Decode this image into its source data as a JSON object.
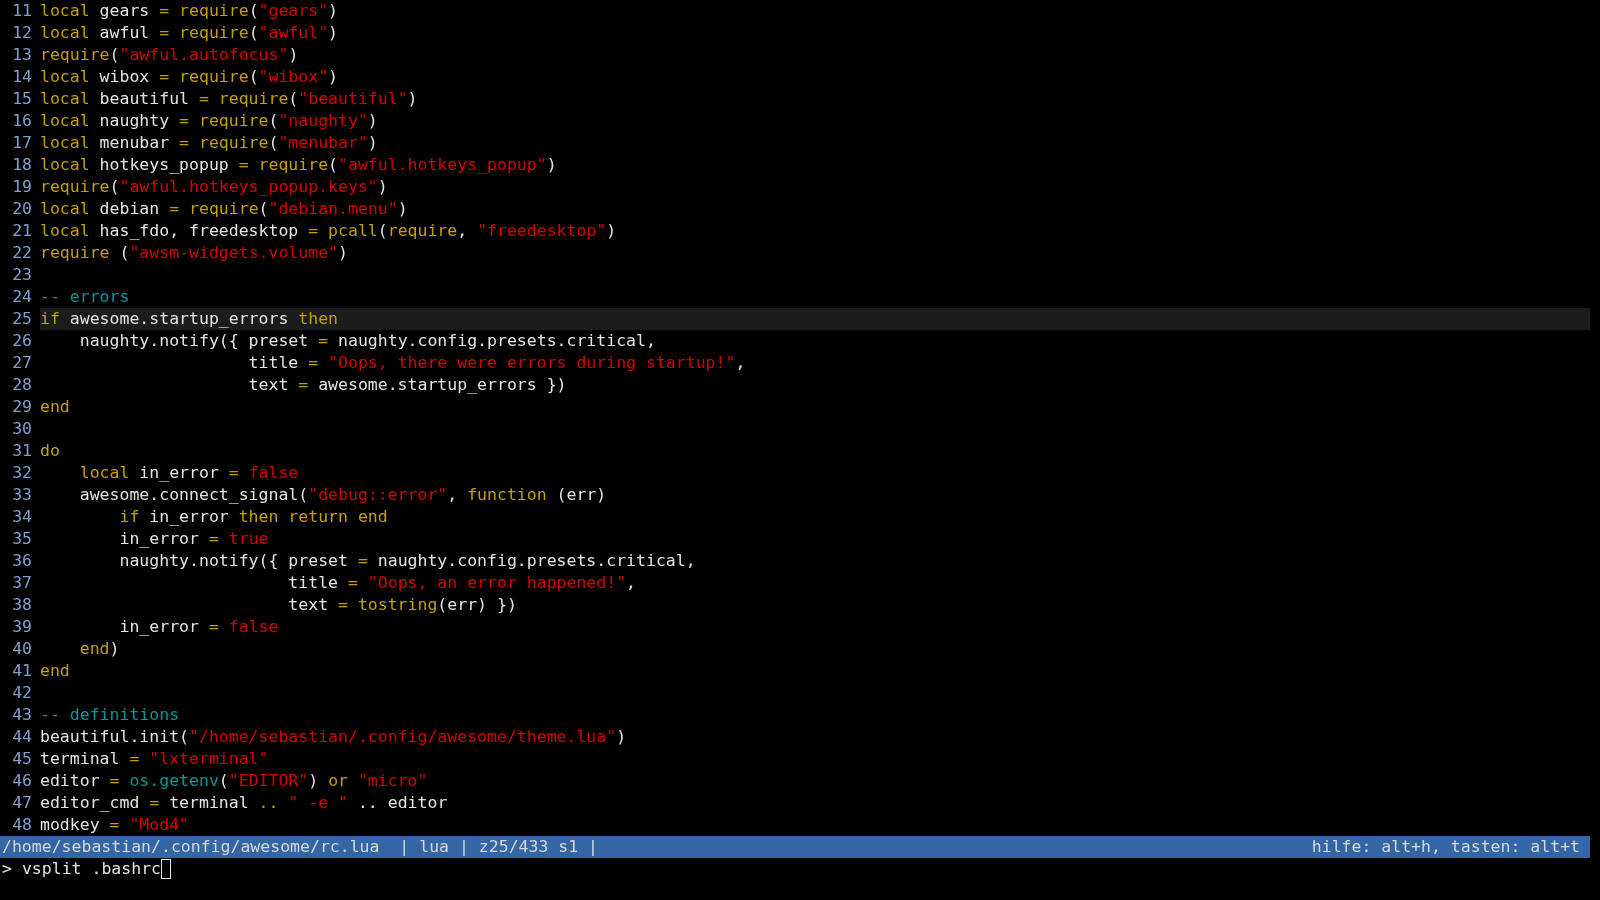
{
  "editor": {
    "lines": [
      {
        "number": "11",
        "current": false,
        "segments": [
          {
            "kind": "keyword",
            "text": "local"
          },
          {
            "kind": "plain",
            "text": " gears "
          },
          {
            "kind": "keyword",
            "text": "= require"
          },
          {
            "kind": "plain",
            "text": "("
          },
          {
            "kind": "string",
            "text": "\"gears\""
          },
          {
            "kind": "plain",
            "text": ")"
          }
        ]
      },
      {
        "number": "12",
        "current": false,
        "segments": [
          {
            "kind": "keyword",
            "text": "local"
          },
          {
            "kind": "plain",
            "text": " awful "
          },
          {
            "kind": "keyword",
            "text": "= require"
          },
          {
            "kind": "plain",
            "text": "("
          },
          {
            "kind": "string",
            "text": "\"awful\""
          },
          {
            "kind": "plain",
            "text": ")"
          }
        ]
      },
      {
        "number": "13",
        "current": false,
        "segments": [
          {
            "kind": "keyword",
            "text": "require"
          },
          {
            "kind": "plain",
            "text": "("
          },
          {
            "kind": "string",
            "text": "\"awful.autofocus\""
          },
          {
            "kind": "plain",
            "text": ")"
          }
        ]
      },
      {
        "number": "14",
        "current": false,
        "segments": [
          {
            "kind": "keyword",
            "text": "local"
          },
          {
            "kind": "plain",
            "text": " wibox "
          },
          {
            "kind": "keyword",
            "text": "= require"
          },
          {
            "kind": "plain",
            "text": "("
          },
          {
            "kind": "string",
            "text": "\"wibox\""
          },
          {
            "kind": "plain",
            "text": ")"
          }
        ]
      },
      {
        "number": "15",
        "current": false,
        "segments": [
          {
            "kind": "keyword",
            "text": "local"
          },
          {
            "kind": "plain",
            "text": " beautiful "
          },
          {
            "kind": "keyword",
            "text": "= require"
          },
          {
            "kind": "plain",
            "text": "("
          },
          {
            "kind": "string",
            "text": "\"beautiful\""
          },
          {
            "kind": "plain",
            "text": ")"
          }
        ]
      },
      {
        "number": "16",
        "current": false,
        "segments": [
          {
            "kind": "keyword",
            "text": "local"
          },
          {
            "kind": "plain",
            "text": " naughty "
          },
          {
            "kind": "keyword",
            "text": "= require"
          },
          {
            "kind": "plain",
            "text": "("
          },
          {
            "kind": "string",
            "text": "\"naughty\""
          },
          {
            "kind": "plain",
            "text": ")"
          }
        ]
      },
      {
        "number": "17",
        "current": false,
        "segments": [
          {
            "kind": "keyword",
            "text": "local"
          },
          {
            "kind": "plain",
            "text": " menubar "
          },
          {
            "kind": "keyword",
            "text": "= require"
          },
          {
            "kind": "plain",
            "text": "("
          },
          {
            "kind": "string",
            "text": "\"menubar\""
          },
          {
            "kind": "plain",
            "text": ")"
          }
        ]
      },
      {
        "number": "18",
        "current": false,
        "segments": [
          {
            "kind": "keyword",
            "text": "local"
          },
          {
            "kind": "plain",
            "text": " hotkeys_popup "
          },
          {
            "kind": "keyword",
            "text": "= require"
          },
          {
            "kind": "plain",
            "text": "("
          },
          {
            "kind": "string",
            "text": "\"awful.hotkeys_popup\""
          },
          {
            "kind": "plain",
            "text": ")"
          }
        ]
      },
      {
        "number": "19",
        "current": false,
        "segments": [
          {
            "kind": "keyword",
            "text": "require"
          },
          {
            "kind": "plain",
            "text": "("
          },
          {
            "kind": "string",
            "text": "\"awful.hotkeys_popup.keys\""
          },
          {
            "kind": "plain",
            "text": ")"
          }
        ]
      },
      {
        "number": "20",
        "current": false,
        "segments": [
          {
            "kind": "keyword",
            "text": "local"
          },
          {
            "kind": "plain",
            "text": " debian "
          },
          {
            "kind": "keyword",
            "text": "= require"
          },
          {
            "kind": "plain",
            "text": "("
          },
          {
            "kind": "string",
            "text": "\"debian.menu\""
          },
          {
            "kind": "plain",
            "text": ")"
          }
        ]
      },
      {
        "number": "21",
        "current": false,
        "segments": [
          {
            "kind": "keyword",
            "text": "local"
          },
          {
            "kind": "plain",
            "text": " has_fdo, freedesktop "
          },
          {
            "kind": "keyword",
            "text": "= pcall"
          },
          {
            "kind": "plain",
            "text": "("
          },
          {
            "kind": "keyword",
            "text": "require"
          },
          {
            "kind": "plain",
            "text": ", "
          },
          {
            "kind": "string",
            "text": "\"freedesktop\""
          },
          {
            "kind": "plain",
            "text": ")"
          }
        ]
      },
      {
        "number": "22",
        "current": false,
        "segments": [
          {
            "kind": "keyword",
            "text": "require"
          },
          {
            "kind": "plain",
            "text": " ("
          },
          {
            "kind": "string",
            "text": "\"awsm-widgets.volume\""
          },
          {
            "kind": "plain",
            "text": ")"
          }
        ]
      },
      {
        "number": "23",
        "current": false
      },
      {
        "number": "24",
        "current": false,
        "segments": [
          {
            "kind": "comment",
            "text": "-- errors"
          }
        ]
      },
      {
        "number": "25",
        "current": true,
        "segments": [
          {
            "kind": "keyword",
            "text": "if"
          },
          {
            "kind": "plain",
            "text": " awesome.startup_errors "
          },
          {
            "kind": "keyword",
            "text": "then"
          }
        ]
      },
      {
        "number": "26",
        "current": false,
        "segments": [
          {
            "kind": "plain",
            "text": "    naughty.notify({ preset "
          },
          {
            "kind": "keyword",
            "text": "="
          },
          {
            "kind": "plain",
            "text": " naughty.config.presets.critical,"
          }
        ]
      },
      {
        "number": "27",
        "current": false,
        "segments": [
          {
            "kind": "plain",
            "text": "                     title "
          },
          {
            "kind": "keyword",
            "text": "= "
          },
          {
            "kind": "string",
            "text": "\"Oops, there were errors during startup!\""
          },
          {
            "kind": "plain",
            "text": ","
          }
        ]
      },
      {
        "number": "28",
        "current": false,
        "segments": [
          {
            "kind": "plain",
            "text": "                     text "
          },
          {
            "kind": "keyword",
            "text": "="
          },
          {
            "kind": "plain",
            "text": " awesome.startup_errors })"
          }
        ]
      },
      {
        "number": "29",
        "current": false,
        "segments": [
          {
            "kind": "keyword",
            "text": "end"
          }
        ]
      },
      {
        "number": "30",
        "current": false
      },
      {
        "number": "31",
        "current": false,
        "segments": [
          {
            "kind": "keyword",
            "text": "do"
          }
        ]
      },
      {
        "number": "32",
        "current": false,
        "segments": [
          {
            "kind": "keyword",
            "text": "    local"
          },
          {
            "kind": "plain",
            "text": " in_error "
          },
          {
            "kind": "keyword",
            "text": "= "
          },
          {
            "kind": "string",
            "text": "false"
          }
        ]
      },
      {
        "number": "33",
        "current": false,
        "segments": [
          {
            "kind": "plain",
            "text": "    awesome.connect_signal("
          },
          {
            "kind": "string",
            "text": "\"debug::error\""
          },
          {
            "kind": "plain",
            "text": ", "
          },
          {
            "kind": "keyword",
            "text": "function"
          },
          {
            "kind": "plain",
            "text": " (err)"
          }
        ]
      },
      {
        "number": "34",
        "current": false,
        "segments": [
          {
            "kind": "keyword",
            "text": "        if"
          },
          {
            "kind": "plain",
            "text": " in_error "
          },
          {
            "kind": "keyword",
            "text": "then return end"
          }
        ]
      },
      {
        "number": "35",
        "current": false,
        "segments": [
          {
            "kind": "plain",
            "text": "        in_error "
          },
          {
            "kind": "keyword",
            "text": "= "
          },
          {
            "kind": "string",
            "text": "true"
          }
        ]
      },
      {
        "number": "36",
        "current": false,
        "segments": [
          {
            "kind": "plain",
            "text": "        naughty.notify({ preset "
          },
          {
            "kind": "keyword",
            "text": "="
          },
          {
            "kind": "plain",
            "text": " naughty.config.presets.critical,"
          }
        ]
      },
      {
        "number": "37",
        "current": false,
        "segments": [
          {
            "kind": "plain",
            "text": "                         title "
          },
          {
            "kind": "keyword",
            "text": "= "
          },
          {
            "kind": "string",
            "text": "\"Oops, an error happened!\""
          },
          {
            "kind": "plain",
            "text": ","
          }
        ]
      },
      {
        "number": "38",
        "current": false,
        "segments": [
          {
            "kind": "plain",
            "text": "                         text "
          },
          {
            "kind": "keyword",
            "text": "= tostring"
          },
          {
            "kind": "plain",
            "text": "(err) })"
          }
        ]
      },
      {
        "number": "39",
        "current": false,
        "segments": [
          {
            "kind": "plain",
            "text": "        in_error "
          },
          {
            "kind": "keyword",
            "text": "= "
          },
          {
            "kind": "string",
            "text": "false"
          }
        ]
      },
      {
        "number": "40",
        "current": false,
        "segments": [
          {
            "kind": "keyword",
            "text": "    end"
          },
          {
            "kind": "plain",
            "text": ")"
          }
        ]
      },
      {
        "number": "41",
        "current": false,
        "segments": [
          {
            "kind": "keyword",
            "text": "end"
          }
        ]
      },
      {
        "number": "42",
        "current": false
      },
      {
        "number": "43",
        "current": false,
        "segments": [
          {
            "kind": "comment",
            "text": "-- definitions"
          }
        ]
      },
      {
        "number": "44",
        "current": false,
        "segments": [
          {
            "kind": "plain",
            "text": "beautiful.init("
          },
          {
            "kind": "string",
            "text": "\"/home/sebastian/.config/awesome/theme.lua\""
          },
          {
            "kind": "plain",
            "text": ")"
          }
        ]
      },
      {
        "number": "45",
        "current": false,
        "segments": [
          {
            "kind": "plain",
            "text": "terminal "
          },
          {
            "kind": "keyword",
            "text": "= "
          },
          {
            "kind": "string",
            "text": "\"lxterminal\""
          }
        ]
      },
      {
        "number": "46",
        "current": false,
        "segments": [
          {
            "kind": "plain",
            "text": "editor "
          },
          {
            "kind": "keyword",
            "text": "= "
          },
          {
            "kind": "comment",
            "text": "os.getenv"
          },
          {
            "kind": "plain",
            "text": "("
          },
          {
            "kind": "string",
            "text": "\"EDITOR\""
          },
          {
            "kind": "plain",
            "text": ") "
          },
          {
            "kind": "keyword",
            "text": "or "
          },
          {
            "kind": "string",
            "text": "\"micro\""
          }
        ]
      },
      {
        "number": "47",
        "current": false,
        "segments": [
          {
            "kind": "plain",
            "text": "editor_cmd "
          },
          {
            "kind": "keyword",
            "text": "="
          },
          {
            "kind": "plain",
            "text": " terminal "
          },
          {
            "kind": "keyword",
            "text": ".. "
          },
          {
            "kind": "string",
            "text": "\" -e \""
          },
          {
            "kind": "plain",
            "text": " .. editor"
          }
        ]
      },
      {
        "number": "48",
        "current": false,
        "segments": [
          {
            "kind": "plain",
            "text": "modkey "
          },
          {
            "kind": "keyword",
            "text": "= "
          },
          {
            "kind": "string",
            "text": "\"Mod4\""
          }
        ]
      }
    ]
  },
  "status_bar": {
    "file_info": "/home/sebastian/.config/awesome/rc.lua  | lua | z25/433 s1 |",
    "help": "hilfe: alt+h, tasten: alt+t"
  },
  "command_line": {
    "prompt": ">",
    "value": "vsplit .bashrc"
  }
}
